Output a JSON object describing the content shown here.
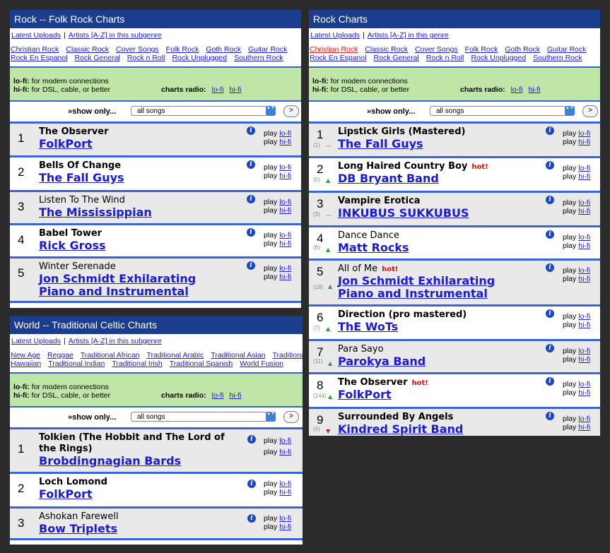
{
  "panels": [
    {
      "title": "Rock -- Folk Rock Charts",
      "links": {
        "uploads": "Latest Uploads",
        "artists": "Artists [A-Z] in this subgenre"
      },
      "genre_rows": [
        [
          "Christian Rock",
          "Classic Rock",
          "Cover Songs",
          "Folk Rock",
          "Goth Rock",
          "Guitar Rock"
        ],
        [
          "Rock En Espanol",
          "Rock General",
          "Rock n Roll",
          "Rock Unplugged",
          "Southern Rock"
        ]
      ],
      "current_genre": "",
      "lofi_text": "for modem connections",
      "hifi_text": "for DSL, cable, or better",
      "lofi_label": "lo-fi:",
      "hifi_label": "hi-fi:",
      "charts_radio": "charts radio:",
      "show_only": "»show only...",
      "select_value": "all songs",
      "go": ">",
      "songs": [
        {
          "rank": "1",
          "song": "The Observer",
          "bold": true,
          "artist": "FolkPort",
          "hot": "",
          "prev": "",
          "trend": ""
        },
        {
          "rank": "2",
          "song": "Bells Of Change",
          "bold": true,
          "artist": "The Fall Guys",
          "hot": "",
          "prev": "",
          "trend": ""
        },
        {
          "rank": "3",
          "song": "Listen To The Wind",
          "bold": false,
          "artist": "The Mississippian",
          "hot": "",
          "prev": "",
          "trend": ""
        },
        {
          "rank": "4",
          "song": "Babel Tower",
          "bold": true,
          "artist": "Rick Gross",
          "hot": "",
          "prev": "",
          "trend": ""
        },
        {
          "rank": "5",
          "song": "Winter Serenade",
          "bold": false,
          "artist": "Jon Schmidt Exhilarating Piano and Instrumental",
          "hot": "",
          "prev": "",
          "trend": ""
        }
      ]
    },
    {
      "title": "Rock Charts",
      "links": {
        "uploads": "Latest Uploads",
        "artists": "Artists [A-Z] in this genre"
      },
      "genre_rows": [
        [
          "Christian Rock",
          "Classic Rock",
          "Cover Songs",
          "Folk Rock",
          "Goth Rock",
          "Guitar Rock"
        ],
        [
          "Rock En Espanol",
          "Rock General",
          "Rock n Roll",
          "Rock Unplugged",
          "Southern Rock"
        ]
      ],
      "current_genre": "Christian Rock",
      "lofi_text": "for modem connections",
      "hifi_text": "for DSL, cable, or better",
      "lofi_label": "lo-fi:",
      "hifi_label": "hi-fi:",
      "charts_radio": "charts radio:",
      "show_only": "»show only...",
      "select_value": "all songs",
      "go": ">",
      "songs": [
        {
          "rank": "1",
          "song": "Lipstick Girls (Mastered)",
          "bold": true,
          "artist": "The Fall Guys",
          "hot": "",
          "prev": "(1)",
          "trend": "same"
        },
        {
          "rank": "2",
          "song": "Long Haired Country Boy",
          "bold": true,
          "artist": "DB Bryant Band",
          "hot": "hot!",
          "prev": "(5)",
          "trend": "up"
        },
        {
          "rank": "3",
          "song": "Vampire Erotica",
          "bold": true,
          "artist": "INKUBUS SUKKUBUS",
          "hot": "",
          "prev": "(3)",
          "trend": "same"
        },
        {
          "rank": "4",
          "song": "Dance Dance",
          "bold": false,
          "artist": "Matt Rocks",
          "hot": "",
          "prev": "(6)",
          "trend": "up"
        },
        {
          "rank": "5",
          "song": "All of Me",
          "bold": false,
          "artist": "Jon Schmidt Exhilarating Piano and Instrumental",
          "hot": "hot!",
          "prev": "(18)",
          "trend": "up"
        },
        {
          "rank": "6",
          "song": "Direction (pro mastered)",
          "bold": true,
          "artist": "ThE WoTs",
          "hot": "",
          "prev": "(7)",
          "trend": "up"
        },
        {
          "rank": "7",
          "song": "Para Sayo",
          "bold": false,
          "artist": "Parokya Band",
          "hot": "",
          "prev": "(11)",
          "trend": "up"
        },
        {
          "rank": "8",
          "song": "The Observer",
          "bold": true,
          "artist": "FolkPort",
          "hot": "hot!",
          "prev": "(144)",
          "trend": "up"
        },
        {
          "rank": "9",
          "song": "Surrounded By Angels",
          "bold": true,
          "artist": "Kindred Spirit Band",
          "hot": "",
          "prev": "(4)",
          "trend": "down"
        }
      ]
    },
    {
      "title": "World -- Traditional Celtic Charts",
      "links": {
        "uploads": "Latest Uploads",
        "artists": "Artists [A-Z] in this subgenre"
      },
      "genre_rows": [
        [
          "New Age",
          "Reggae",
          "Traditional African",
          "Traditional Arabic",
          "Traditional Asian",
          "Traditional"
        ],
        [
          "Hawaiian",
          "Traditional Indian",
          "Traditional Irish",
          "Traditional Spanish",
          "World Fusion"
        ]
      ],
      "current_genre": "",
      "lofi_text": "for modem connections",
      "hifi_text": "for DSL, cable, or better",
      "lofi_label": "lo-fi:",
      "hifi_label": "hi-fi:",
      "charts_radio": "charts radio:",
      "show_only": "»show only...",
      "select_value": "all songs",
      "go": ">",
      "songs": [
        {
          "rank": "1",
          "song": "Tolkien (The Hobbit and The Lord of the Rings)",
          "bold": true,
          "artist": "Brobdingnagian Bards",
          "hot": "",
          "prev": "",
          "trend": ""
        },
        {
          "rank": "2",
          "song": "Loch Lomond",
          "bold": true,
          "artist": "FolkPort",
          "hot": "",
          "prev": "",
          "trend": ""
        },
        {
          "rank": "3",
          "song": "Ashokan Farewell",
          "bold": false,
          "artist": "Bow Triplets",
          "hot": "",
          "prev": "",
          "trend": ""
        }
      ]
    }
  ],
  "common": {
    "play": "play",
    "lofi": "lo-fi",
    "hifi": "hi-fi",
    "info": "i"
  },
  "icons": {
    "info": "info-icon",
    "up": "up-arrow-icon",
    "down": "down-arrow-icon",
    "same": "no-change-icon"
  }
}
